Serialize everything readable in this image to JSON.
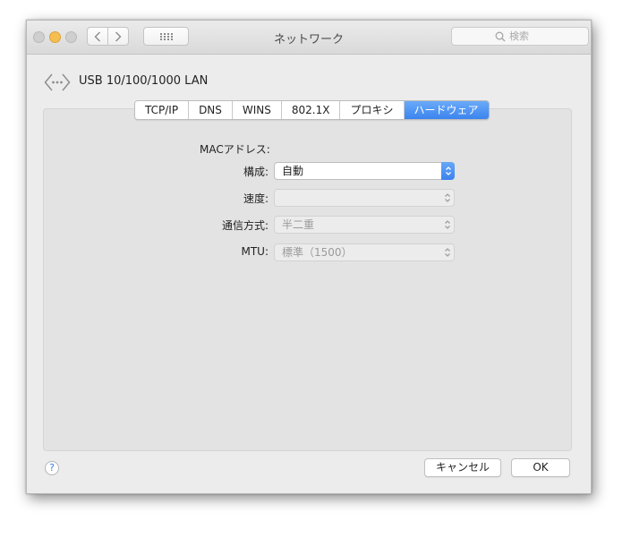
{
  "window": {
    "title": "ネットワーク"
  },
  "toolbar": {
    "search_placeholder": "検索"
  },
  "device": {
    "name": "USB 10/100/1000 LAN"
  },
  "tabs": [
    {
      "label": "TCP/IP",
      "active": false
    },
    {
      "label": "DNS",
      "active": false
    },
    {
      "label": "WINS",
      "active": false
    },
    {
      "label": "802.1X",
      "active": false
    },
    {
      "label": "プロキシ",
      "active": false
    },
    {
      "label": "ハードウェア",
      "active": true
    }
  ],
  "hardware": {
    "mac_label": "MACアドレス:",
    "config": {
      "label": "構成:",
      "value": "自動",
      "enabled": true
    },
    "speed": {
      "label": "速度:",
      "value": "",
      "enabled": false
    },
    "duplex": {
      "label": "通信方式:",
      "value": "半二重",
      "enabled": false
    },
    "mtu": {
      "label": "MTU:",
      "value": "標準（1500）",
      "enabled": false
    }
  },
  "footer": {
    "help_label": "?",
    "cancel_label": "キャンセル",
    "ok_label": "OK"
  },
  "colors": {
    "accent": "#3b84ef",
    "minimize": "#f5be4f"
  }
}
